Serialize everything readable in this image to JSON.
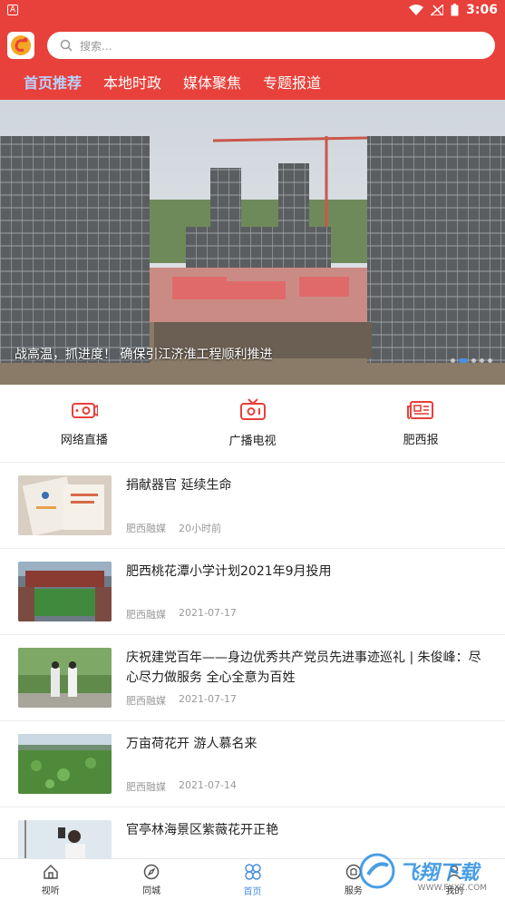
{
  "status_bar": {
    "badge": "A",
    "time": "3:06"
  },
  "search": {
    "placeholder": "搜索..."
  },
  "tabs": [
    {
      "label": "首页推荐",
      "active": true
    },
    {
      "label": "本地时政",
      "active": false
    },
    {
      "label": "媒体聚焦",
      "active": false
    },
    {
      "label": "专题报道",
      "active": false
    }
  ],
  "banner": {
    "caption": "战高温，抓进度！ 确保引江济淮工程顺利推进",
    "slides": 5,
    "active_slide": 2
  },
  "quick_nav": [
    {
      "label": "网络直播",
      "icon": "camera-icon"
    },
    {
      "label": "广播电视",
      "icon": "tv-icon"
    },
    {
      "label": "肥西报",
      "icon": "newspaper-icon"
    }
  ],
  "news": [
    {
      "title": "捐献器官 延续生命",
      "source": "肥西融媒",
      "time": "20小时前"
    },
    {
      "title": "肥西桃花潭小学计划2021年9月投用",
      "source": "肥西融媒",
      "time": "2021-07-17"
    },
    {
      "title": "庆祝建党百年——身边优秀共产党员先进事迹巡礼 | 朱俊峰：尽心尽力做服务 全心全意为百姓",
      "source": "肥西融媒",
      "time": "2021-07-17"
    },
    {
      "title": "万亩荷花开 游人慕名来",
      "source": "肥西融媒",
      "time": "2021-07-14"
    },
    {
      "title": "官亭林海景区紫薇花开正艳",
      "source": "",
      "time": ""
    }
  ],
  "bottom_nav": [
    {
      "label": "视听",
      "icon": "home-icon",
      "active": false
    },
    {
      "label": "同城",
      "icon": "compass-icon",
      "active": false
    },
    {
      "label": "首页",
      "icon": "clover-icon",
      "active": true
    },
    {
      "label": "服务",
      "icon": "service-icon",
      "active": false
    },
    {
      "label": "我的",
      "icon": "user-icon",
      "active": false
    }
  ],
  "watermark": {
    "text": "飞翔下载",
    "sub": "WWW.FXXZ.COM"
  },
  "colors": {
    "brand_red": "#e8403a",
    "accent_blue": "#4a90e2"
  }
}
